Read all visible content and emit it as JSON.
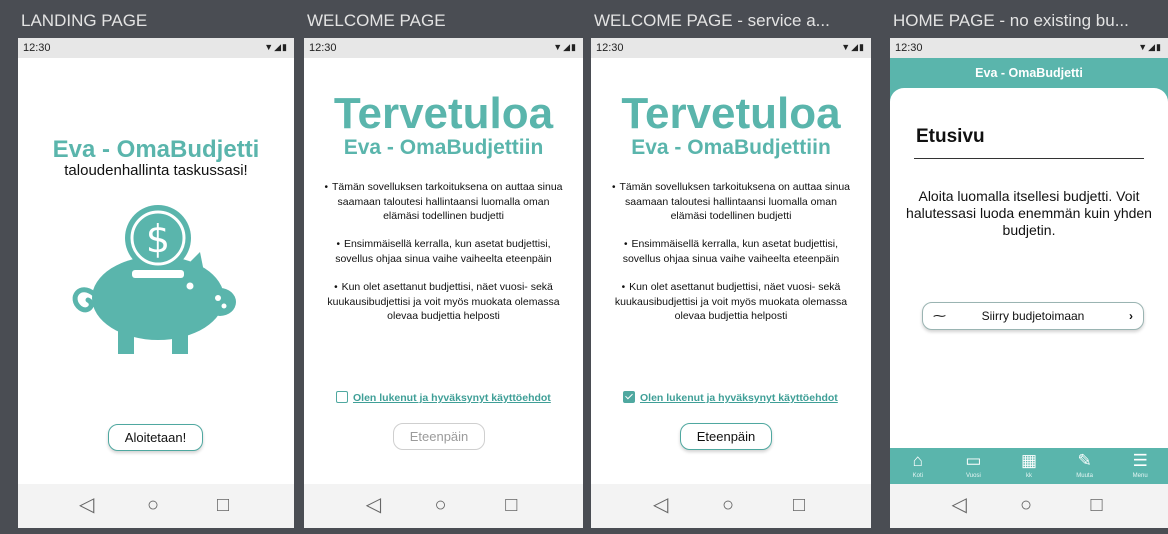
{
  "status": {
    "time": "12:30",
    "signal_icons": "▼◢▮"
  },
  "nav": {
    "back": "◁",
    "home": "○",
    "recent": "□"
  },
  "landing": {
    "frame_label": "LANDING PAGE",
    "title": "Eva - OmaBudjetti",
    "subtitle": "taloudenhallinta taskussasi!",
    "start_button": "Aloitetaan!"
  },
  "welcome": {
    "frame_label": "WELCOME PAGE",
    "title": "Tervetuloa",
    "subtitle": "Eva - OmaBudjettiin",
    "bullets": [
      "Tämän sovelluksen tarkoituksena on auttaa sinua saamaan taloutesi hallintaansi luomalla oman elämäsi todellinen budjetti",
      "Ensimmäisellä kerralla, kun asetat budjettisi, sovellus ohjaa sinua vaihe vaiheelta eteenpäin",
      "Kun olet asettanut budjettisi, näet vuosi- sekä kuukausibudjettisi ja voit myös muokata olemassa olevaa budjettia helposti"
    ],
    "terms_label": "Olen lukenut ja hyväksynyt käyttöehdot",
    "terms_checked": false,
    "next_button": "Eteenpäin"
  },
  "welcome_accepted": {
    "frame_label": "WELCOME PAGE - service a...",
    "terms_checked": true
  },
  "home": {
    "frame_label": "HOME PAGE - no existing bu...",
    "header_title": "Eva - OmaBudjetti",
    "heading": "Etusivu",
    "body_text": "Aloita luomalla itsellesi budjetti. Voit halutessasi luoda enemmän kuin yhden budjetin.",
    "budget_button": "Siirry budjetoimaan",
    "budget_button_icon": "pulse-icon",
    "tabs": [
      {
        "icon": "home-icon",
        "glyph": "⌂",
        "label": "Koti"
      },
      {
        "icon": "clipboard-icon",
        "glyph": "▭",
        "label": "Vuosi"
      },
      {
        "icon": "calendar-icon",
        "glyph": "▦",
        "label": "kk"
      },
      {
        "icon": "edit-icon",
        "glyph": "✎",
        "label": "Muuta"
      },
      {
        "icon": "menu-icon",
        "glyph": "☰",
        "label": "Menu"
      }
    ]
  },
  "colors": {
    "brand": "#5ab5ac",
    "background": "#4a4d53"
  }
}
